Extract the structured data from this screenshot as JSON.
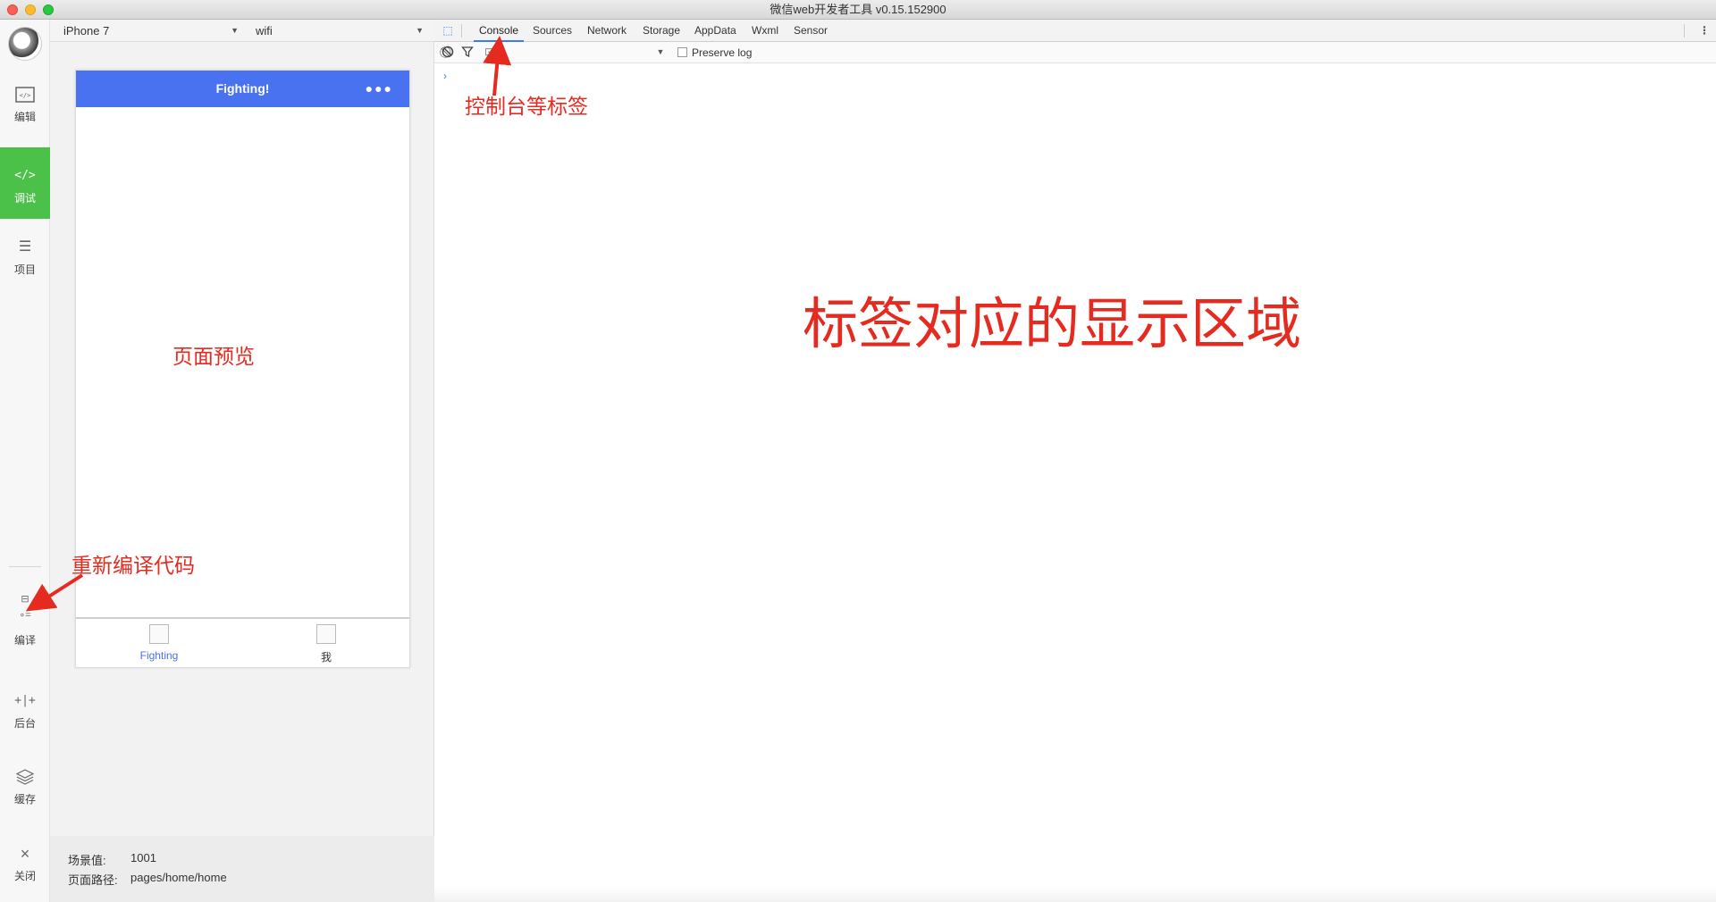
{
  "window": {
    "title": "微信web开发者工具 v0.15.152900"
  },
  "sidebar": {
    "items": [
      {
        "label": "编辑",
        "icon": "code-box-icon"
      },
      {
        "label": "调试",
        "icon": "code-brackets-icon",
        "active": true
      },
      {
        "label": "项目",
        "icon": "menu-lines-icon"
      },
      {
        "label": "编译",
        "icon": "compile-icon"
      },
      {
        "label": "后台",
        "icon": "background-icon"
      },
      {
        "label": "缓存",
        "icon": "layers-icon"
      },
      {
        "label": "关闭",
        "icon": "close-icon"
      }
    ]
  },
  "simulator": {
    "device": "iPhone 7",
    "network": "wifi",
    "nav_title": "Fighting!",
    "tabs": [
      {
        "label": "Fighting",
        "active": true
      },
      {
        "label": "我"
      }
    ],
    "footer": {
      "scene_label": "场景值:",
      "scene_value": "1001",
      "path_label": "页面路径:",
      "path_value": "pages/home/home"
    }
  },
  "devtools": {
    "tabs": [
      "Console",
      "Sources",
      "Network",
      "Storage",
      "AppData",
      "Wxml",
      "Sensor"
    ],
    "active_tab": "Console",
    "preserve_log": "Preserve log",
    "prompt": "›"
  },
  "annotations": {
    "tabs_note": "控制台等标签",
    "display_area": "标签对应的显示区域",
    "preview": "页面预览",
    "recompile": "重新编译代码"
  },
  "colors": {
    "accent_green": "#4cc14a",
    "nav_blue": "#4872f0",
    "annotation_red": "#e52a20"
  }
}
